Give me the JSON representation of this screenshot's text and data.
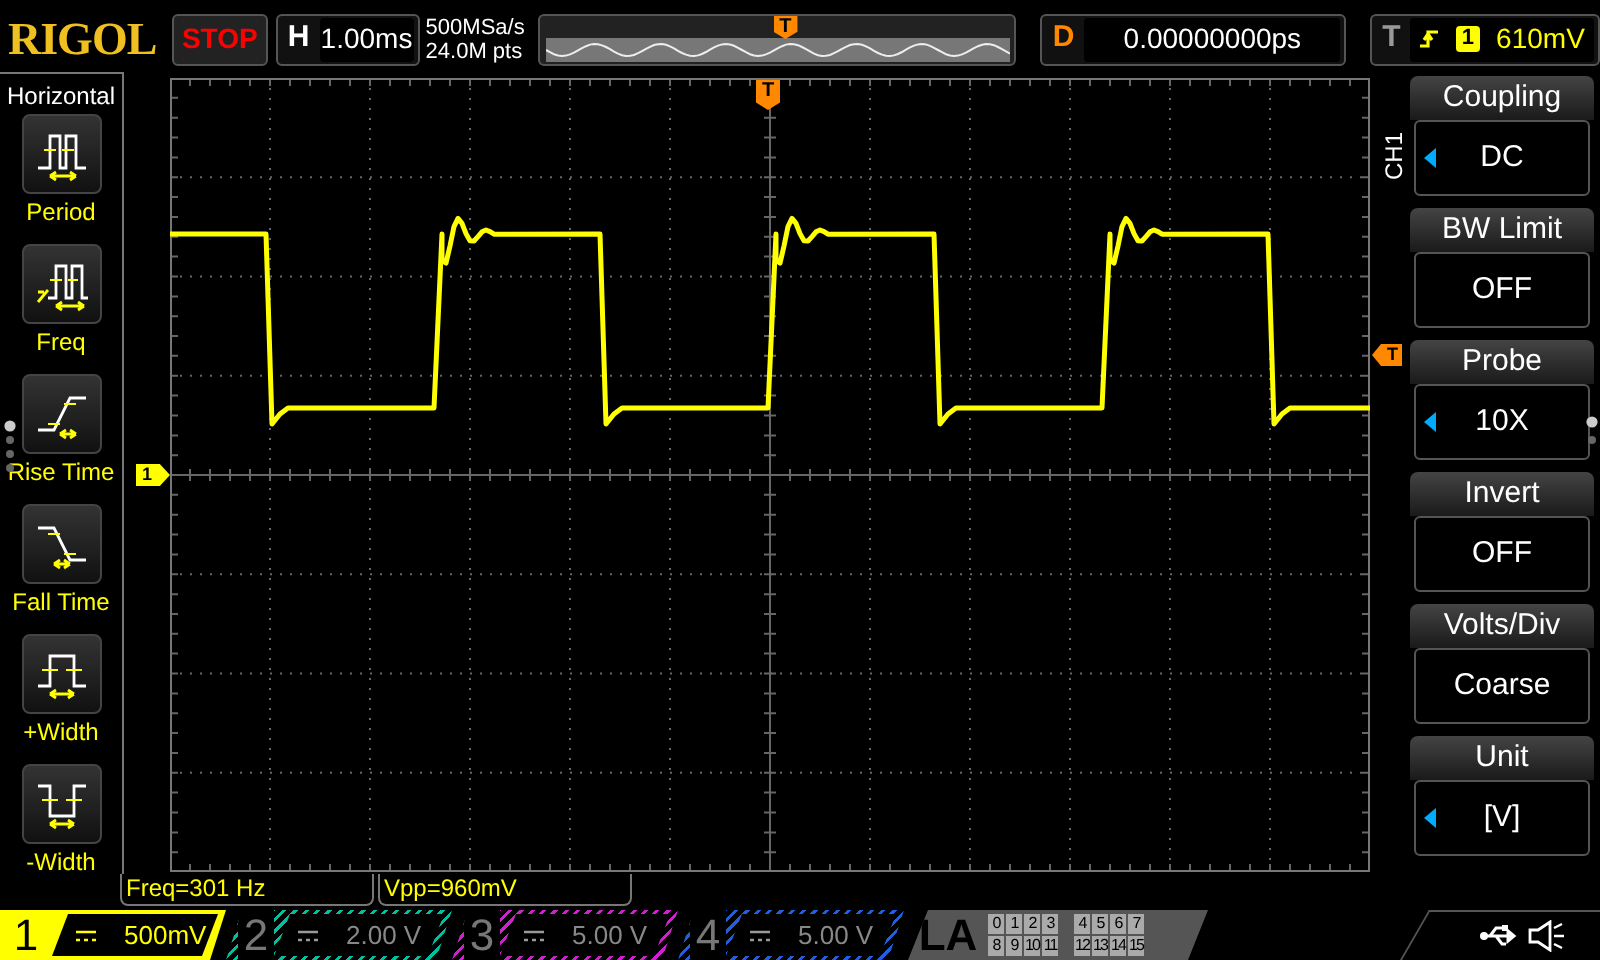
{
  "header": {
    "logo": "RIGOL",
    "run_state": "STOP",
    "timebase_label": "H",
    "timebase": "1.00ms",
    "sample_rate": "500MSa/s",
    "memory_depth": "24.0M pts",
    "delay_label": "D",
    "delay": "0.00000000ps",
    "trigger_label": "T",
    "trigger_source": "1",
    "trigger_level": "610mV"
  },
  "markers": {
    "overview_trigger_position": "T",
    "trigger_position": "T",
    "trigger_level": "T",
    "channel": "1"
  },
  "measure_panel": {
    "title": "Horizontal",
    "items": [
      {
        "kind": "period",
        "label": "Period"
      },
      {
        "kind": "freq",
        "label": "Freq"
      },
      {
        "kind": "rise",
        "label": "Rise Time"
      },
      {
        "kind": "fall",
        "label": "Fall Time"
      },
      {
        "kind": "pwidth",
        "label": "+Width"
      },
      {
        "kind": "nwidth",
        "label": "-Width"
      }
    ]
  },
  "menu": {
    "channel": "CH1",
    "items": [
      {
        "title": "Coupling",
        "value": "DC",
        "adjustable": true
      },
      {
        "title": "BW Limit",
        "value": "OFF",
        "adjustable": false
      },
      {
        "title": "Probe",
        "value": "10X",
        "adjustable": true
      },
      {
        "title": "Invert",
        "value": "OFF",
        "adjustable": false
      },
      {
        "title": "Volts/Div",
        "value": "Coarse",
        "adjustable": false
      },
      {
        "title": "Unit",
        "value": "[V]",
        "adjustable": true
      }
    ]
  },
  "measurements": [
    {
      "text": "Freq=301 Hz"
    },
    {
      "text": "Vpp=960mV"
    }
  ],
  "channels": [
    {
      "number": "1",
      "scale": "500mV",
      "selected": true,
      "color": "#ffff00"
    },
    {
      "number": "2",
      "scale": "2.00 V",
      "selected": false,
      "color": "#00c0a0"
    },
    {
      "number": "3",
      "scale": "5.00 V",
      "selected": false,
      "color": "#d020d0"
    },
    {
      "number": "4",
      "scale": "5.00 V",
      "selected": false,
      "color": "#2060e0"
    }
  ],
  "la": {
    "label": "LA",
    "bits": [
      "0",
      "1",
      "2",
      "3",
      "4",
      "5",
      "6",
      "7",
      "8",
      "9",
      "10",
      "11",
      "12",
      "13",
      "14",
      "15"
    ]
  }
}
